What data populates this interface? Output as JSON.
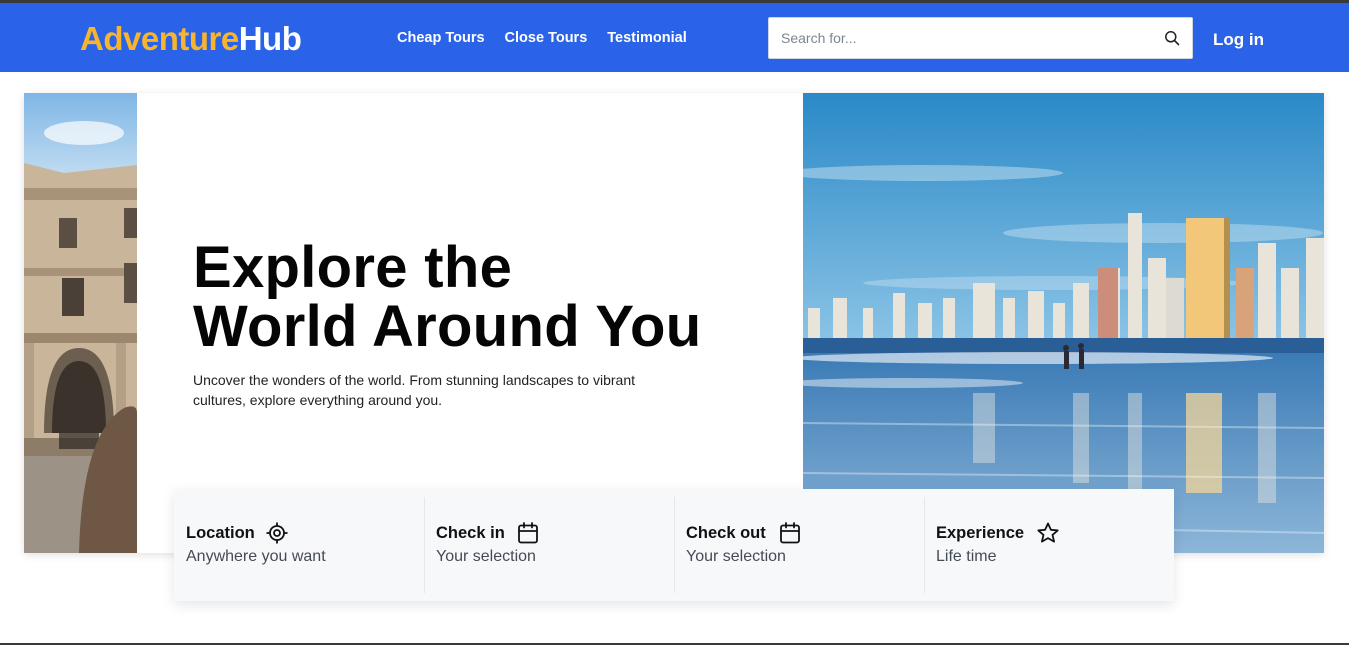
{
  "brand": {
    "part1": "Adventure",
    "part2": "Hub",
    "color1": "#f7b42c",
    "color2": "#ffffff"
  },
  "nav": {
    "background": "#2b63e8",
    "links": [
      {
        "label": "Cheap Tours"
      },
      {
        "label": "Close Tours"
      },
      {
        "label": "Testimonial"
      }
    ],
    "search": {
      "placeholder": "Search for...",
      "icon": "search-icon"
    },
    "login_label": "Log in"
  },
  "hero": {
    "title_line1": "Explore the",
    "title_line2": "World Around You",
    "subtitle": "Uncover the wonders of the world. From stunning landscapes to vibrant cultures, explore everything around you.",
    "left_image": "historic-palace-photo",
    "right_image": "beach-city-skyline-photo"
  },
  "booking": [
    {
      "title": "Location",
      "value": "Anywhere you want",
      "icon": "location-target-icon"
    },
    {
      "title": "Check in",
      "value": "Your selection",
      "icon": "calendar-icon"
    },
    {
      "title": "Check out",
      "value": "Your selection",
      "icon": "calendar-icon"
    },
    {
      "title": "Experience",
      "value": "Life time",
      "icon": "star-icon"
    }
  ]
}
